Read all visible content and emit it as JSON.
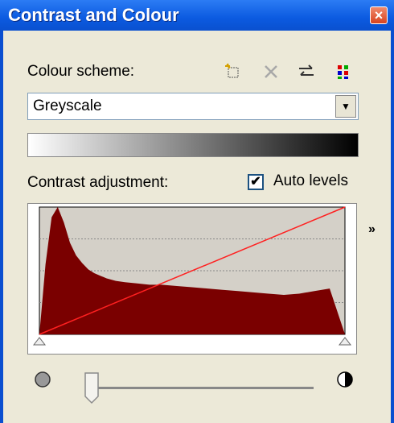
{
  "window": {
    "title": "Contrast and Colour",
    "close_label": "×"
  },
  "colour_scheme": {
    "label": "Colour scheme:",
    "selected": "Greyscale",
    "tools": [
      "new-scheme-icon",
      "delete-scheme-icon",
      "swap-icon",
      "palette-icon"
    ]
  },
  "contrast": {
    "label": "Contrast adjustment:",
    "auto_levels_label": "Auto levels",
    "auto_levels_checked": true,
    "expand_label": "»"
  },
  "colors": {
    "histogram": "#7a0000",
    "line": "#ff2020",
    "plot_bg": "#d4d0c8",
    "title_bar": "#0b5ae0"
  },
  "chart_data": {
    "type": "area",
    "title": "",
    "xlabel": "",
    "ylabel": "",
    "grid": true,
    "x": [
      0,
      2,
      4,
      6,
      8,
      10,
      12,
      14,
      16,
      18,
      20,
      22,
      25,
      28,
      32,
      36,
      40,
      45,
      50,
      55,
      60,
      65,
      70,
      75,
      80,
      85,
      90,
      95,
      100
    ],
    "values": [
      0,
      0.55,
      0.92,
      1.0,
      0.88,
      0.72,
      0.62,
      0.56,
      0.51,
      0.48,
      0.46,
      0.44,
      0.42,
      0.41,
      0.4,
      0.39,
      0.39,
      0.38,
      0.37,
      0.36,
      0.35,
      0.34,
      0.33,
      0.32,
      0.31,
      0.32,
      0.34,
      0.36,
      0.0
    ],
    "ylim": [
      0,
      1
    ],
    "line": {
      "x": [
        0,
        100
      ],
      "y": [
        0,
        1
      ]
    }
  }
}
